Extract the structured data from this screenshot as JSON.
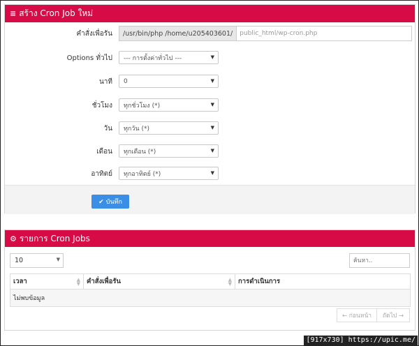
{
  "create_panel": {
    "title": "สร้าง Cron Job ใหม่",
    "command_label": "คำสั่งเพื่อรัน",
    "command_prefix": "/usr/bin/php /home/u205403601/",
    "command_value": "public_html/wp-cron.php",
    "options_label": "Options ทั่วไป",
    "options_value": "--- การตั้งค่าทั่วไป ---",
    "minute_label": "นาที",
    "minute_value": "0",
    "hour_label": "ชั่วโมง",
    "hour_value": "ทุกชั่วโมง (*)",
    "day_label": "วัน",
    "day_value": "ทุกวัน (*)",
    "month_label": "เดือน",
    "month_value": "ทุกเดือน (*)",
    "weekday_label": "อาทิตย์",
    "weekday_value": "ทุกอาทิตย์ (*)",
    "save_label": "บันทึก"
  },
  "list_panel": {
    "title": "รายการ Cron Jobs",
    "page_length": "10",
    "search_placeholder": "ค้นหา..",
    "columns": [
      "เวลา",
      "คำสั่งเพื่อรัน",
      "การดำเนินการ"
    ],
    "empty_text": "ไม่พบข้อมูล",
    "prev_label": "← ก่อนหน้า",
    "next_label": "ถัดไป →"
  },
  "caption": "[917x730] https://upic.me/",
  "colors": {
    "accent": "#d70b45",
    "button": "#3a8ee6"
  },
  "icons": {
    "create_panel": "list-icon",
    "list_panel": "gears-icon",
    "save": "check-icon"
  }
}
